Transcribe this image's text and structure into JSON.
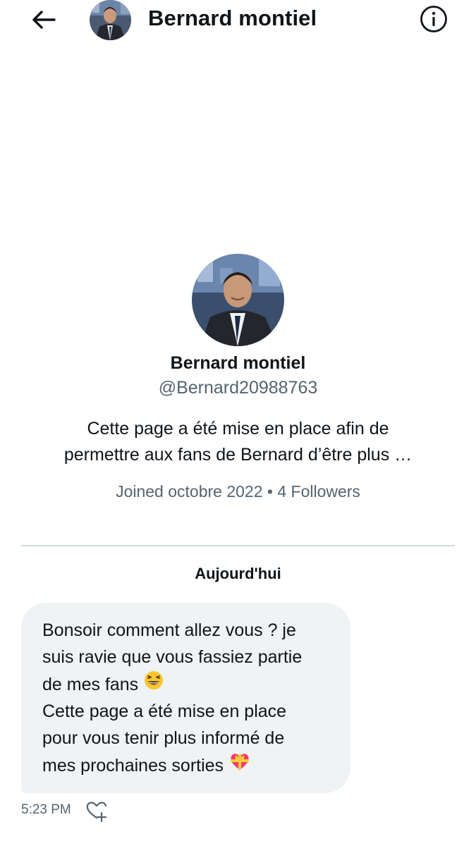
{
  "header": {
    "back_icon": "arrow-left-icon",
    "title": "Bernard montiel",
    "info_icon": "info-icon"
  },
  "profile": {
    "name": "Bernard montiel",
    "handle": "@Bernard20988763",
    "bio_line1": "Cette page a été mise en place afin de",
    "bio_line2": "permettre aux fans de Bernard d’être plus …",
    "meta": "Joined octobre 2022 • 4 Followers"
  },
  "conversation": {
    "date_label": "Aujourd'hui",
    "message": {
      "lines": [
        "Bonsoir comment allez vous ? je",
        "suis ravie que vous fassiez partie",
        "de mes fans",
        "Cette page a été mise en place",
        "pour vous tenir plus informé de",
        "mes prochaines sorties"
      ],
      "emoji_1": "grinning-squinting-face-emoji",
      "emoji_2": "heart-with-ribbon-emoji",
      "time": "5:23 PM",
      "reaction_icon": "add-reaction-heart-icon"
    }
  },
  "colors": {
    "text_primary": "#0f1419",
    "text_secondary": "#536471",
    "bubble_bg": "#eff3f4",
    "divider": "#cfd9de"
  }
}
